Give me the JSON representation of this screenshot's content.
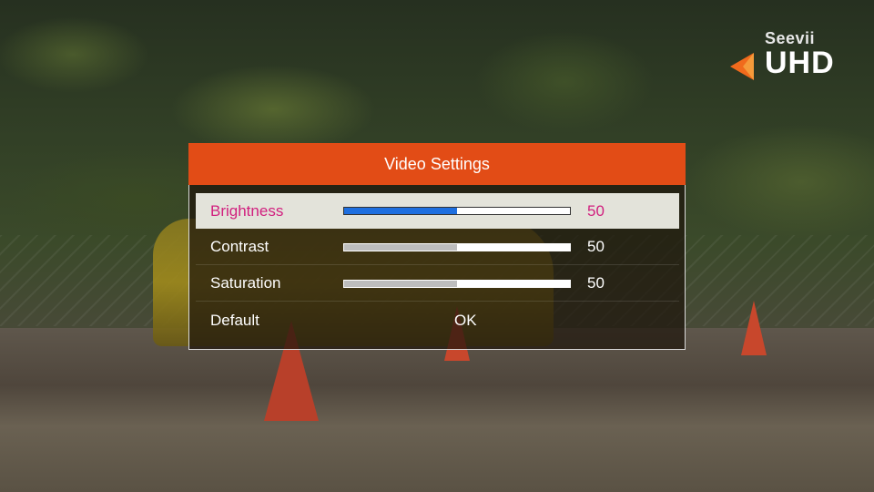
{
  "logo": {
    "brand": "Seevii",
    "product": "UHD",
    "accent_color": "#f06a1c"
  },
  "dialog": {
    "title": "Video Settings",
    "header_color": "#e24c16",
    "rows": [
      {
        "label": "Brightness",
        "value": "50",
        "level": 0.5,
        "selected": true
      },
      {
        "label": "Contrast",
        "value": "50",
        "level": 0.5,
        "selected": false
      },
      {
        "label": "Saturation",
        "value": "50",
        "level": 0.5,
        "selected": false
      }
    ],
    "default_row": {
      "label": "Default",
      "action": "OK"
    },
    "colors": {
      "selected_text": "#d11f7e",
      "selected_fill": "#1e6fe0",
      "unselected_fill": "#bdbdbd"
    }
  }
}
